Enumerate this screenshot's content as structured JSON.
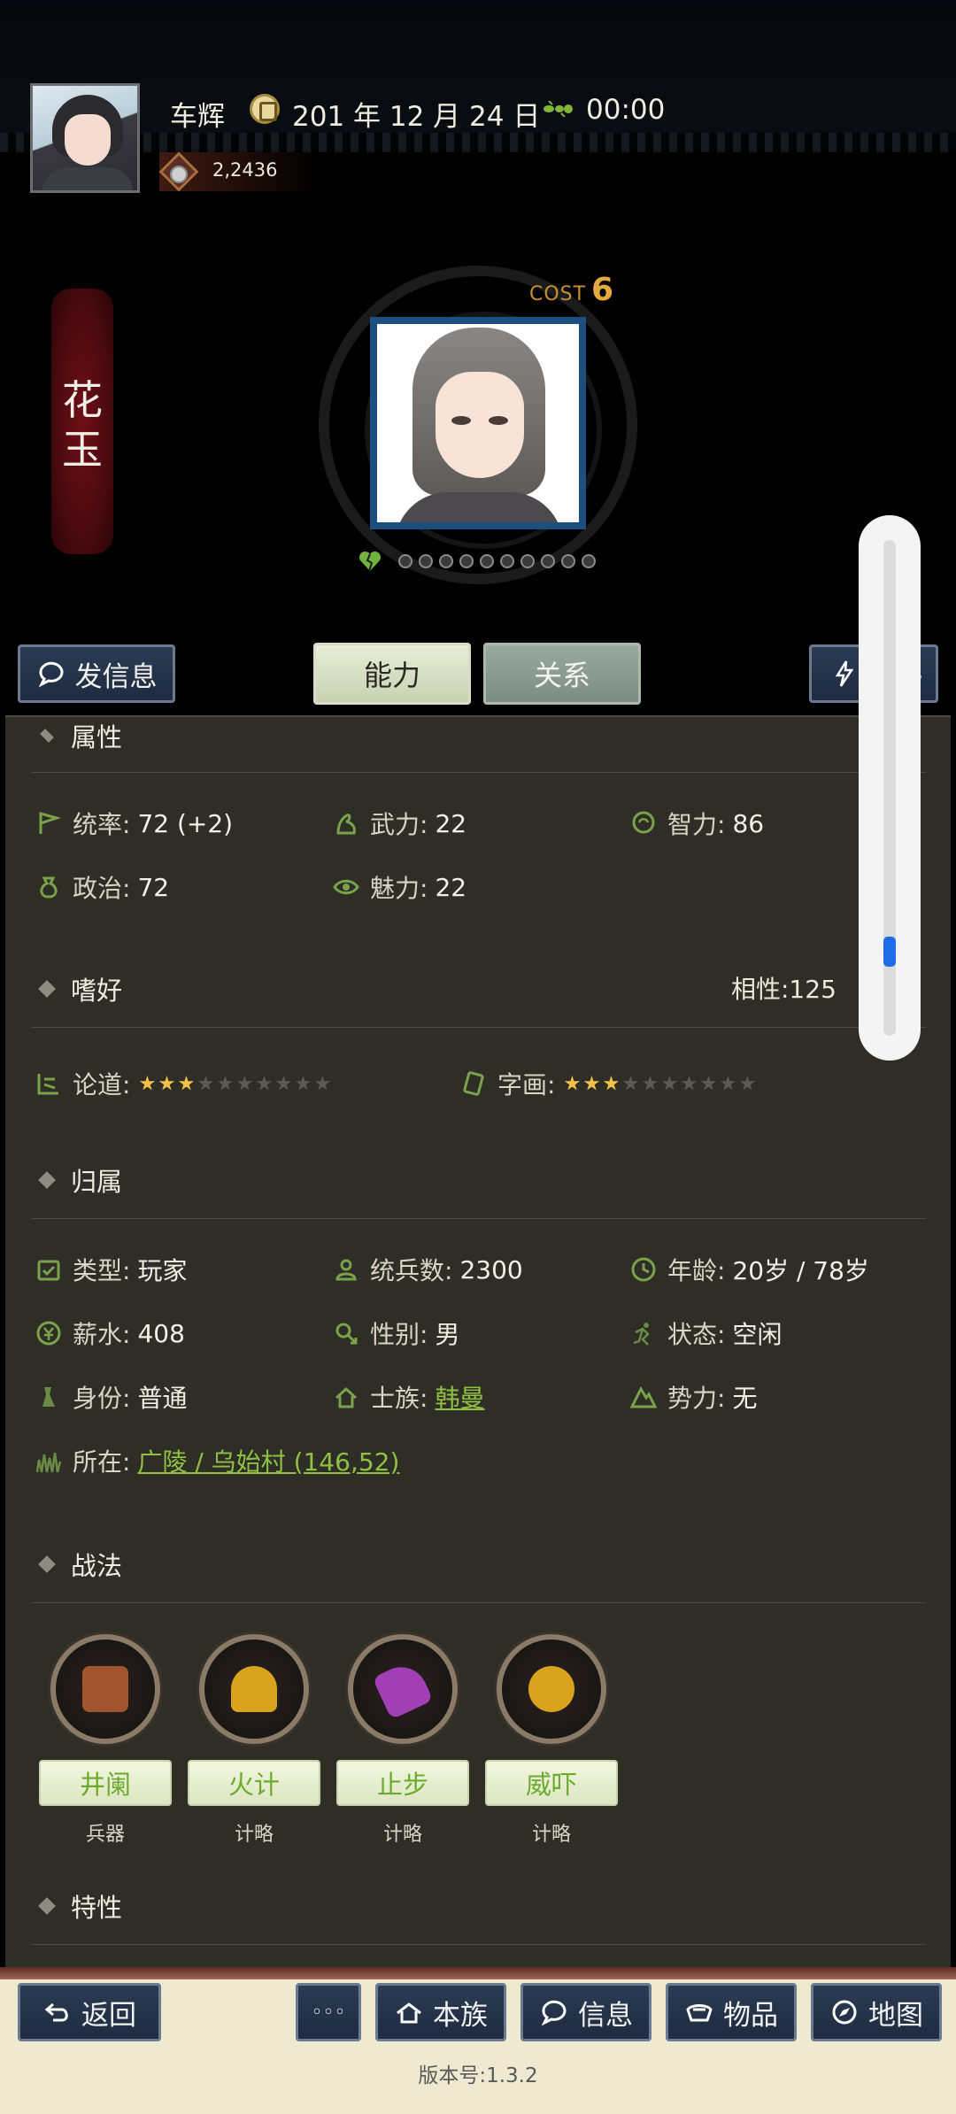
{
  "header": {
    "player_name": "车辉",
    "date": "201 年 12 月 24 日",
    "time": "00:00",
    "coins": "2,2436"
  },
  "character": {
    "name_char_1": "花",
    "name_char_2": "玉",
    "cost_label": "COST",
    "cost_value": "6"
  },
  "tabs": {
    "send_message": "发信息",
    "ability": "能力",
    "relation": "关系",
    "hidden_right": "迁移"
  },
  "attributes": {
    "section_title": "属性",
    "command_label": "统率:",
    "command_value": "72 (+2)",
    "force_label": "武力:",
    "force_value": "22",
    "intellect_label": "智力:",
    "intellect_value": "86",
    "politics_label": "政治:",
    "politics_value": "72",
    "charm_label": "魅力:",
    "charm_value": "22"
  },
  "hobby": {
    "section_title": "嗜好",
    "affinity": "相性:125",
    "hobby1_label": "论道:",
    "hobby1_stars": 3,
    "hobby2_label": "字画:",
    "hobby2_stars": 3,
    "max_stars": 10
  },
  "affiliation": {
    "section_title": "归属",
    "type_label": "类型:",
    "type_value": "玩家",
    "troops_label": "统兵数:",
    "troops_value": "2300",
    "age_label": "年龄:",
    "age_value": "20岁 / 78岁",
    "salary_label": "薪水:",
    "salary_value": "408",
    "gender_label": "性别:",
    "gender_value": "男",
    "status_label": "状态:",
    "status_value": "空闲",
    "rank_label": "身份:",
    "rank_value": "普通",
    "clan_label": "士族:",
    "clan_value": "韩曼",
    "faction_label": "势力:",
    "faction_value": "无",
    "location_label": "所在:",
    "location_value": "广陵 / 乌始村 (146,52)"
  },
  "tactics": {
    "section_title": "战法",
    "items": [
      {
        "name": "井阑",
        "type": "兵器",
        "color": "#a0552e"
      },
      {
        "name": "火计",
        "type": "计略",
        "color": "#d9a320"
      },
      {
        "name": "止步",
        "type": "计略",
        "color": "#a23fb5"
      },
      {
        "name": "威吓",
        "type": "计略",
        "color": "#d9a320"
      }
    ]
  },
  "traits": {
    "section_title": "特性"
  },
  "bottom_nav": {
    "back": "返回",
    "more": "◦◦◦",
    "clan": "本族",
    "info": "信息",
    "items": "物品",
    "map": "地图",
    "version": "版本号:1.3.2"
  },
  "colors": {
    "accent_green": "#8fc041",
    "panel_bg": "#2e2e27",
    "scroll_thumb": "#1f6de6"
  }
}
